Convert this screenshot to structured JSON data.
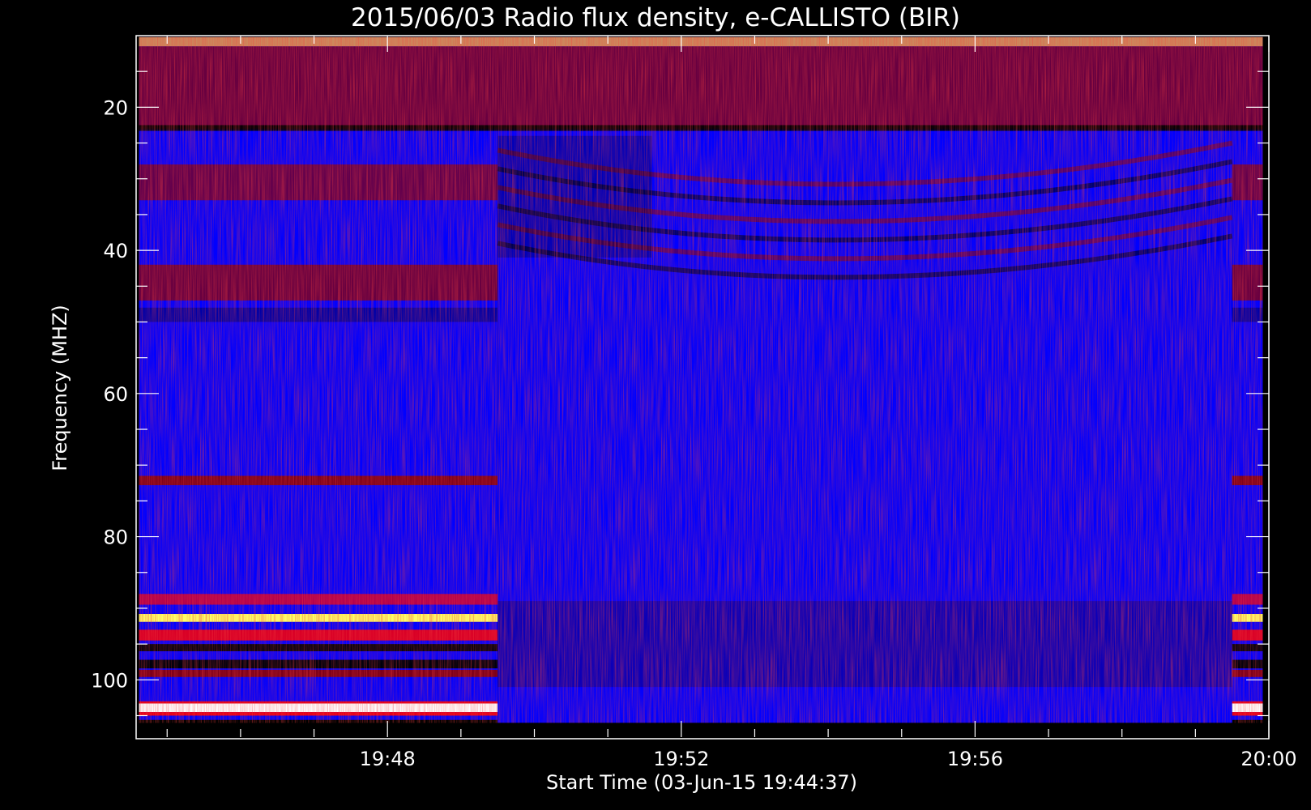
{
  "chart_data": {
    "type": "heatmap",
    "title": "2015/06/03  Radio flux density, e-CALLISTO (BIR)",
    "xlabel": "Start Time (03-Jun-15 19:44:37)",
    "ylabel": "Frequency (MHZ)",
    "x_start": "19:44:37",
    "x_end": "19:59:55",
    "xlim_minutes": [
      44.6,
      60.0
    ],
    "ylim": [
      108,
      10
    ],
    "y_inverted": true,
    "x_ticks": [
      "19:48",
      "19:52",
      "19:56",
      "20:00"
    ],
    "x_tick_minutes": [
      48,
      52,
      56,
      60
    ],
    "y_ticks": [
      "20",
      "40",
      "60",
      "80",
      "100"
    ],
    "y_tick_values": [
      20,
      40,
      60,
      80,
      100
    ],
    "data_time_range_minutes": [
      44.62,
      59.92
    ],
    "data_freq_range_mhz": [
      10.2,
      105.6
    ],
    "colormap": [
      "#000000",
      "#0000ff",
      "#8b0000",
      "#ff0000",
      "#ffff66",
      "#ffffff"
    ],
    "segments": [
      {
        "start": "19:44:37",
        "end": "19:49:30",
        "freq_max_mhz": 105.6
      },
      {
        "start": "19:49:30",
        "end": "19:59:30",
        "freq_max_mhz": 106.0
      },
      {
        "start": "19:59:30",
        "end": "19:59:55",
        "freq_max_mhz": 105.6
      }
    ],
    "bright_bands_mhz": [
      88.5,
      91.5,
      93.5,
      99,
      104
    ],
    "grid": false
  }
}
